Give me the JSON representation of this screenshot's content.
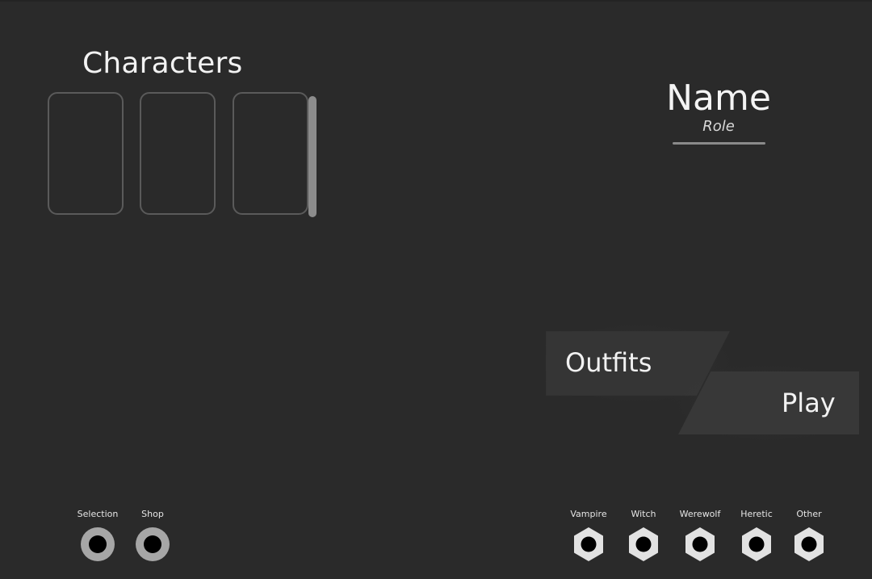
{
  "characters": {
    "title": "Characters",
    "slots": [
      {
        "label": ""
      },
      {
        "label": ""
      },
      {
        "label": ""
      }
    ]
  },
  "profile": {
    "name": "Name",
    "role": "Role"
  },
  "actions": {
    "outfits_label": "Outfits",
    "play_label": "Play"
  },
  "nav_left": {
    "items": [
      {
        "label": "Selection",
        "icon": "ring-icon"
      },
      {
        "label": "Shop",
        "icon": "ring-icon"
      }
    ]
  },
  "nav_right": {
    "items": [
      {
        "label": "Vampire",
        "icon": "hexagon-icon"
      },
      {
        "label": "Witch",
        "icon": "hexagon-icon"
      },
      {
        "label": "Werewolf",
        "icon": "hexagon-icon"
      },
      {
        "label": "Heretic",
        "icon": "hexagon-icon"
      },
      {
        "label": "Other",
        "icon": "hexagon-icon"
      }
    ]
  },
  "colors": {
    "background": "#2a2a2a",
    "ring_outer": "#a6a6a6",
    "hex_fill": "#e2e2e2",
    "icon_hole": "#000000"
  }
}
